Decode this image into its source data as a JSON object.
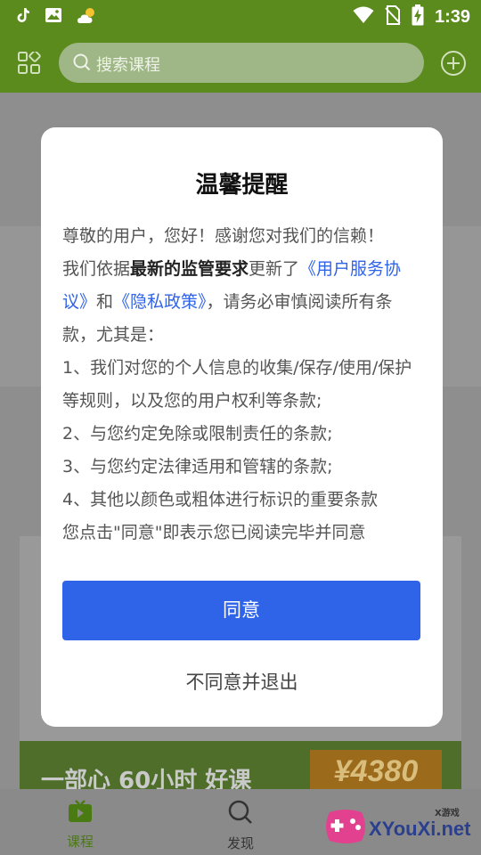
{
  "status_bar": {
    "time": "1:39",
    "icons": [
      "tiktok-icon",
      "image-icon",
      "weather-icon",
      "wifi-icon",
      "no-sim-icon",
      "battery-charging-icon"
    ]
  },
  "header": {
    "search_placeholder": "搜索课程"
  },
  "dialog": {
    "title": "温馨提醒",
    "intro_greeting": "尊敬的用户，您好！感谢您对我们的信赖！",
    "intro_pre": "我们依据",
    "intro_bold": "最新的监管要求",
    "intro_mid": "更新了",
    "link_service": "《用户服务协议》",
    "intro_and": "和",
    "link_privacy": "《隐私政策》",
    "intro_post": "，请务必审慎阅读所有条款，尤其是：",
    "items": [
      "1、我们对您的个人信息的收集/保存/使用/保护等规则，以及您的用户权利等条款;",
      "2、与您约定免除或限制责任的条款;",
      "3、与您约定法律适用和管辖的条款;",
      "4、其他以颜色或粗体进行标识的重要条款"
    ],
    "consent_note": "您点击\"同意\"即表示您已阅读完毕并同意",
    "agree_label": "同意",
    "disagree_label": "不同意并退出"
  },
  "banner": {
    "price": "¥4380",
    "text": "一部心   60小时 好课"
  },
  "bottom_nav": {
    "items": [
      {
        "label": "课程",
        "icon": "tv-icon",
        "active": true
      },
      {
        "label": "发现",
        "icon": "search-icon",
        "active": false
      }
    ]
  },
  "watermark": {
    "text": "XYouXi.net",
    "small": "X游戏"
  },
  "colors": {
    "brand_green": "#5b8a1d",
    "primary_blue": "#2f63e8",
    "nav_active": "#4a7a12"
  }
}
